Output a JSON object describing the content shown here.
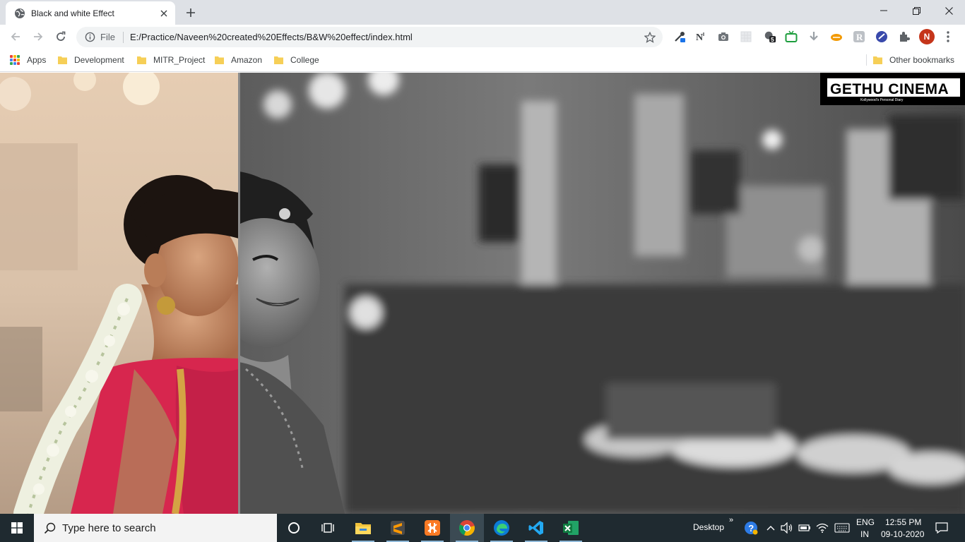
{
  "browser": {
    "tab_title": "Black and white Effect",
    "omnibox": {
      "scheme_label": "File",
      "url": "E:/Practice/Naveen%20created%20Effects/B&W%20effect/index.html"
    },
    "profile_initial": "N",
    "extension_badge": "5",
    "bookmarks": {
      "apps_label": "Apps",
      "items": [
        "Development",
        "MITR_Project",
        "Amazon",
        "College"
      ],
      "other_label": "Other bookmarks"
    }
  },
  "page": {
    "logo_title": "GETHU CINEMA",
    "logo_tagline": "Kollywood's Personal Diary",
    "divider_fraction": 0.247
  },
  "taskbar": {
    "search_placeholder": "Type here to search",
    "desktop_label": "Desktop",
    "language": "ENG",
    "region": "IN",
    "time": "12:55 PM",
    "date": "09-10-2020"
  },
  "colors": {
    "tabstrip": "#dee1e6",
    "taskbar": "#1f2a30",
    "avatar": "#c5351a",
    "logo_bg": "#000000"
  }
}
